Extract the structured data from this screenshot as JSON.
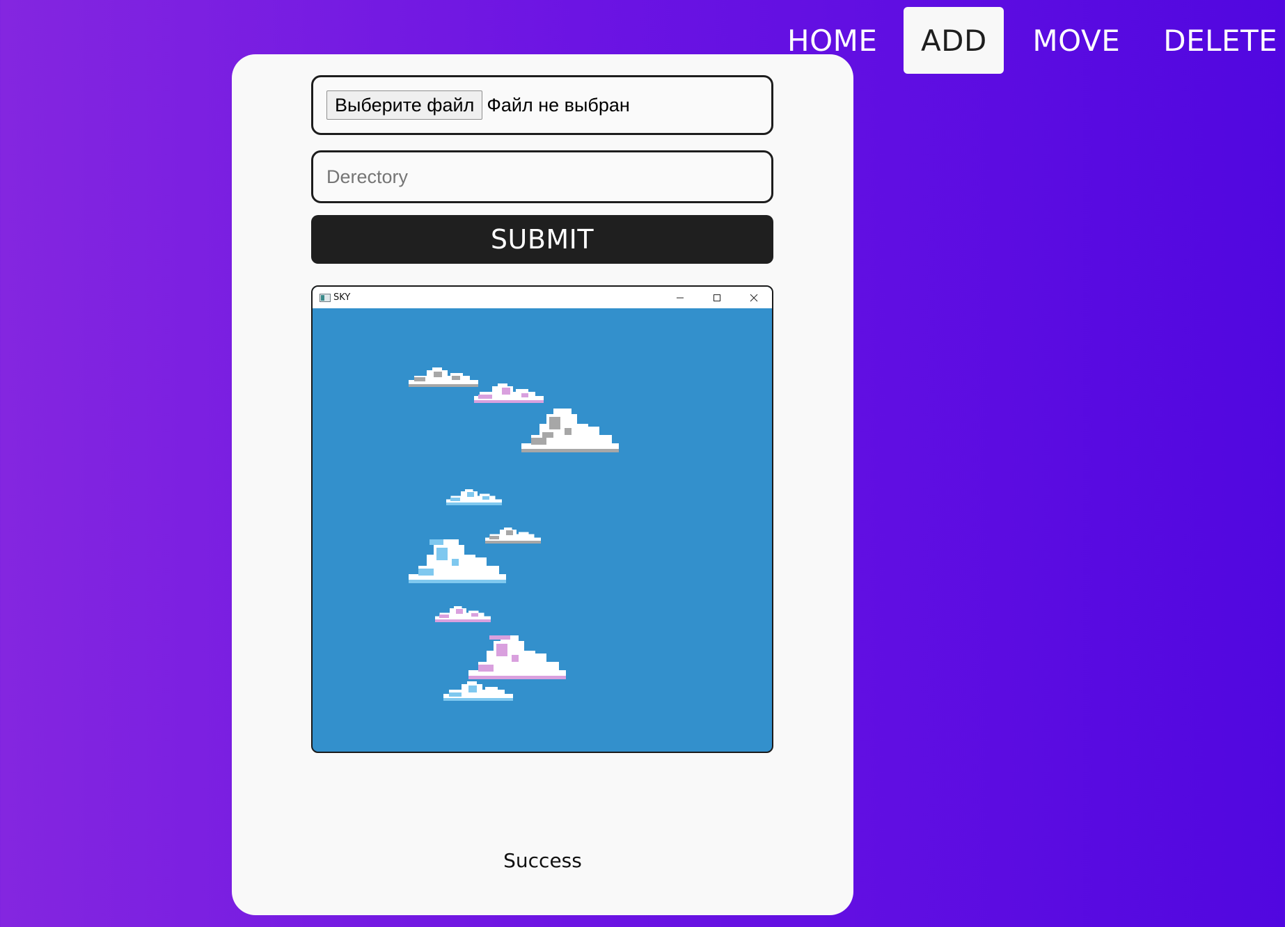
{
  "nav": {
    "items": [
      {
        "label": "HOME",
        "active": false
      },
      {
        "label": "ADD",
        "active": true
      },
      {
        "label": "MOVE",
        "active": false
      },
      {
        "label": "DELETE",
        "active": false
      }
    ]
  },
  "form": {
    "file_button_label": "Выберите файл",
    "file_status": "Файл не выбран",
    "directory_placeholder": "Derectory",
    "directory_value": "",
    "submit_label": "SUBMIT"
  },
  "preview": {
    "window_title": "SKY",
    "icon": "window-app-icon",
    "controls": [
      "minimize-icon",
      "maximize-icon",
      "close-icon"
    ],
    "sky_color": "#3390cc",
    "cloud_colors": [
      "#ffffff",
      "#a7a7a7",
      "#d9a0de",
      "#7fc8ef"
    ]
  },
  "status": {
    "message": "Success"
  },
  "colors": {
    "background_start": "#8426e0",
    "background_end": "#5107e0",
    "card": "#f9f9f9",
    "submit": "#1f1f1f"
  }
}
